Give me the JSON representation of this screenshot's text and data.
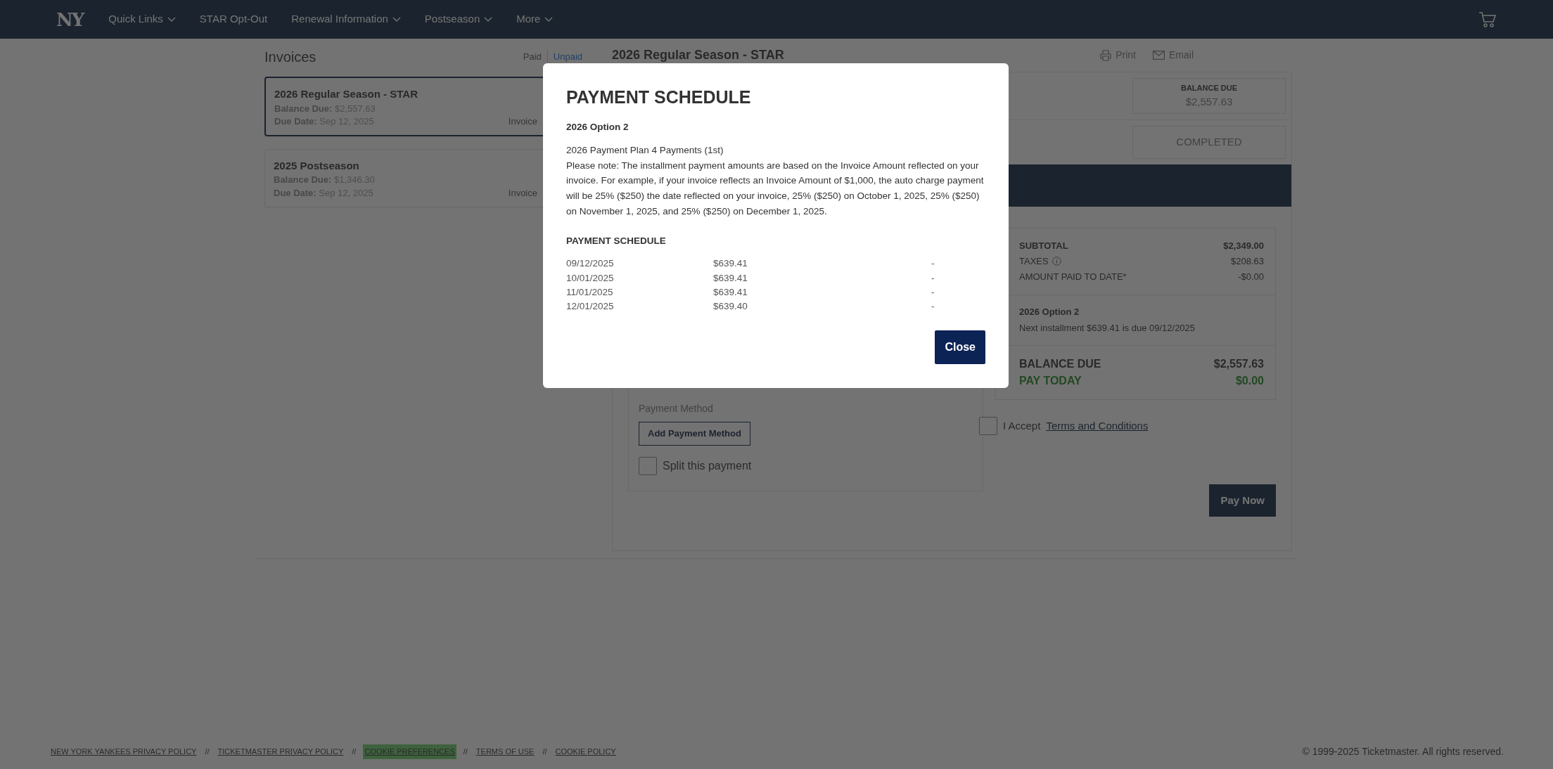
{
  "nav": {
    "logo": "NY",
    "items": [
      {
        "label": "Quick Links",
        "has_menu": true
      },
      {
        "label": "STAR Opt-Out",
        "has_menu": false
      },
      {
        "label": "Renewal Information",
        "has_menu": true
      },
      {
        "label": "Postseason",
        "has_menu": true
      },
      {
        "label": "More",
        "has_menu": true
      }
    ]
  },
  "invoices": {
    "title": "Invoices",
    "filters": [
      {
        "label": "Paid",
        "selected": false
      },
      {
        "label": "Unpaid",
        "selected": true
      }
    ],
    "items": [
      {
        "title": "2026 Regular Season - STAR",
        "balance_label": "Balance Due:",
        "balance": "$2,557.63",
        "due_label": "Due Date:",
        "due": "Sep 12, 2025",
        "invoice_label": "Invoice",
        "selected": true
      },
      {
        "title": "2025 Postseason",
        "balance_label": "Balance Due:",
        "balance": "$1,346.30",
        "due_label": "Due Date:",
        "due": "Sep 12, 2025",
        "invoice_label": "Invoice",
        "selected": false
      }
    ]
  },
  "invoice_detail": {
    "title": "2026 Regular Season - STAR",
    "actions": [
      {
        "kind": "print",
        "label": "Print"
      },
      {
        "kind": "email",
        "label": "Email"
      }
    ],
    "balance_box": {
      "label": "BALANCE DUE",
      "value": "$2,557.63"
    },
    "status": "COMPLETED",
    "payment_method": {
      "label": "Payment Method",
      "button": "Add Payment Method"
    },
    "split": {
      "label": "Split this payment",
      "checked": false
    },
    "summary": {
      "rows": [
        {
          "label": "SUBTOTAL",
          "value": "$2,349.00",
          "bold": true,
          "info": false
        },
        {
          "label": "TAXES",
          "value": "$208.63",
          "bold": false,
          "info": true
        },
        {
          "label": "AMOUNT PAID TO DATE*",
          "value": "-$0.00",
          "bold": false,
          "info": false
        }
      ],
      "plan_title": "2026 Option 2",
      "plan_text": "Next installment $639.41 is due 09/12/2025",
      "balance_due": {
        "label": "BALANCE DUE",
        "value": "$2,557.63"
      },
      "pay_today": {
        "label": "PAY TODAY",
        "value": "$0.00"
      }
    },
    "terms": {
      "prefix": "I Accept",
      "link": "Terms and Conditions",
      "checked": false
    },
    "pay_button": "Pay Now"
  },
  "modal": {
    "title": "PAYMENT SCHEDULE",
    "plan_name": "2026 Option 2",
    "plan_line": "2026 Payment Plan 4 Payments (1st)",
    "note": "Please note: The installment payment amounts are based on the Invoice Amount reflected on your invoice. For example, if your invoice reflects an Invoice Amount of $1,000, the auto charge payment will be 25% ($250) the date reflected on your invoice, 25% ($250) on October 1, 2025, 25% ($250) on November 1, 2025, and 25% ($250) on December 1, 2025.",
    "schedule_title": "PAYMENT SCHEDULE",
    "schedule": [
      {
        "date": "09/12/2025",
        "amount": "$639.41",
        "status": "-"
      },
      {
        "date": "10/01/2025",
        "amount": "$639.41",
        "status": "-"
      },
      {
        "date": "11/01/2025",
        "amount": "$639.41",
        "status": "-"
      },
      {
        "date": "12/01/2025",
        "amount": "$639.40",
        "status": "-"
      }
    ],
    "close": "Close"
  },
  "footer": {
    "links": [
      {
        "label": "NEW YORK YANKEES PRIVACY POLICY",
        "highlighted": false
      },
      {
        "label": "TICKETMASTER PRIVACY POLICY",
        "highlighted": false
      },
      {
        "label": "COOKIE PREFERENCES",
        "highlighted": true
      },
      {
        "label": "TERMS OF USE",
        "highlighted": false
      },
      {
        "label": "COOKIE POLICY",
        "highlighted": false
      }
    ],
    "separator": "//",
    "copyright": "© 1999-2025 Ticketmaster. All rights reserved."
  }
}
